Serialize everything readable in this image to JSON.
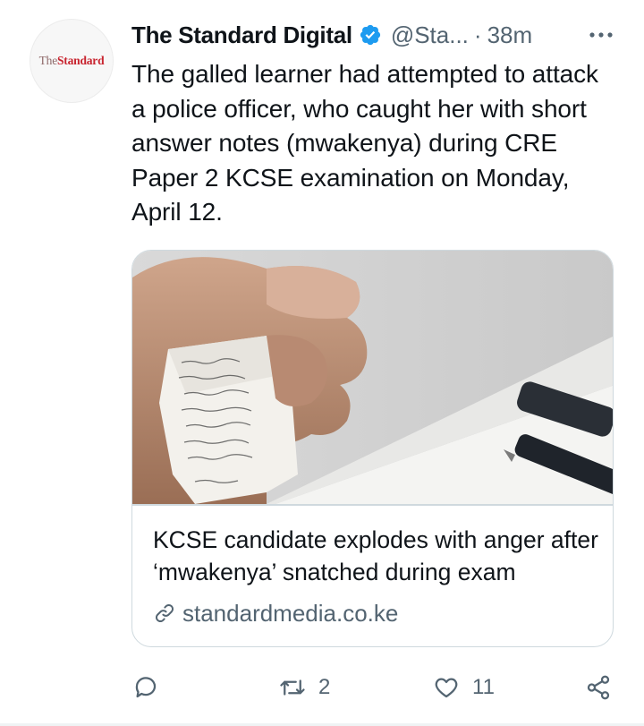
{
  "tweet": {
    "avatar": {
      "logo_the": "The",
      "logo_standard": "Standard"
    },
    "author_name": "The Standard Digital",
    "verified": true,
    "handle": "@Sta...",
    "separator": "·",
    "time": "38m",
    "text": "The galled learner had attempted to attack a police officer, who caught her with short answer notes (mwakenya) during CRE Paper 2 KCSE examination on Monday, April 12.",
    "card": {
      "image_icon": "hand-holding-crumpled-note-photo",
      "title": "KCSE candidate explodes with anger after ‘mwakenya’ snatched during exam",
      "domain": "standardmedia.co.ke"
    },
    "actions": {
      "reply_icon": "reply-icon",
      "retweet_count": "2",
      "like_count": "11",
      "share_icon": "share-icon"
    }
  },
  "colors": {
    "text": "#0f1419",
    "secondary": "#536471",
    "verified_blue": "#1d9bf0",
    "border": "#cfd9de",
    "logo_red": "#c8242f"
  }
}
